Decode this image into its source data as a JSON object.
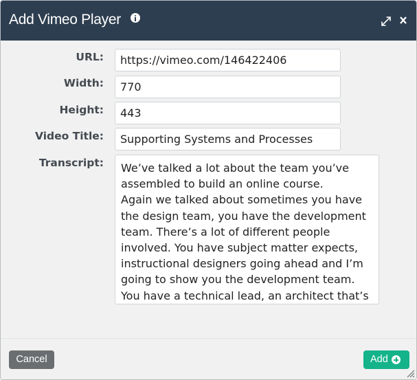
{
  "dialog": {
    "title": "Add Vimeo Player",
    "icons": {
      "info": "info-icon",
      "expand": "expand-icon",
      "close": "close-icon",
      "resize": "resize-grip-icon"
    },
    "close_label": "x"
  },
  "form": {
    "url": {
      "label": "URL:",
      "value": "https://vimeo.com/146422406"
    },
    "width": {
      "label": "Width:",
      "value": "770"
    },
    "height": {
      "label": "Height:",
      "value": "443"
    },
    "video_title": {
      "label": "Video Title:",
      "value": "Supporting Systems and Processes"
    },
    "transcript": {
      "label": "Transcript:",
      "value": "We’ve talked a lot about the team you’ve assembled to build an online course.\nAgain we talked about sometimes you have the design team, you have the development team. There’s a lot of different people involved. You have subject matter expects, instructional designers going ahead and I’m going to show you the development team. You have a technical lead, an architect that’s"
    }
  },
  "footer": {
    "cancel_label": "Cancel",
    "add_label": "Add"
  },
  "colors": {
    "titlebar": "#2d3e50",
    "body": "#f1f1f1",
    "label_text": "#444a51",
    "cancel_button": "#6b6e70",
    "add_button": "#15b38a"
  }
}
